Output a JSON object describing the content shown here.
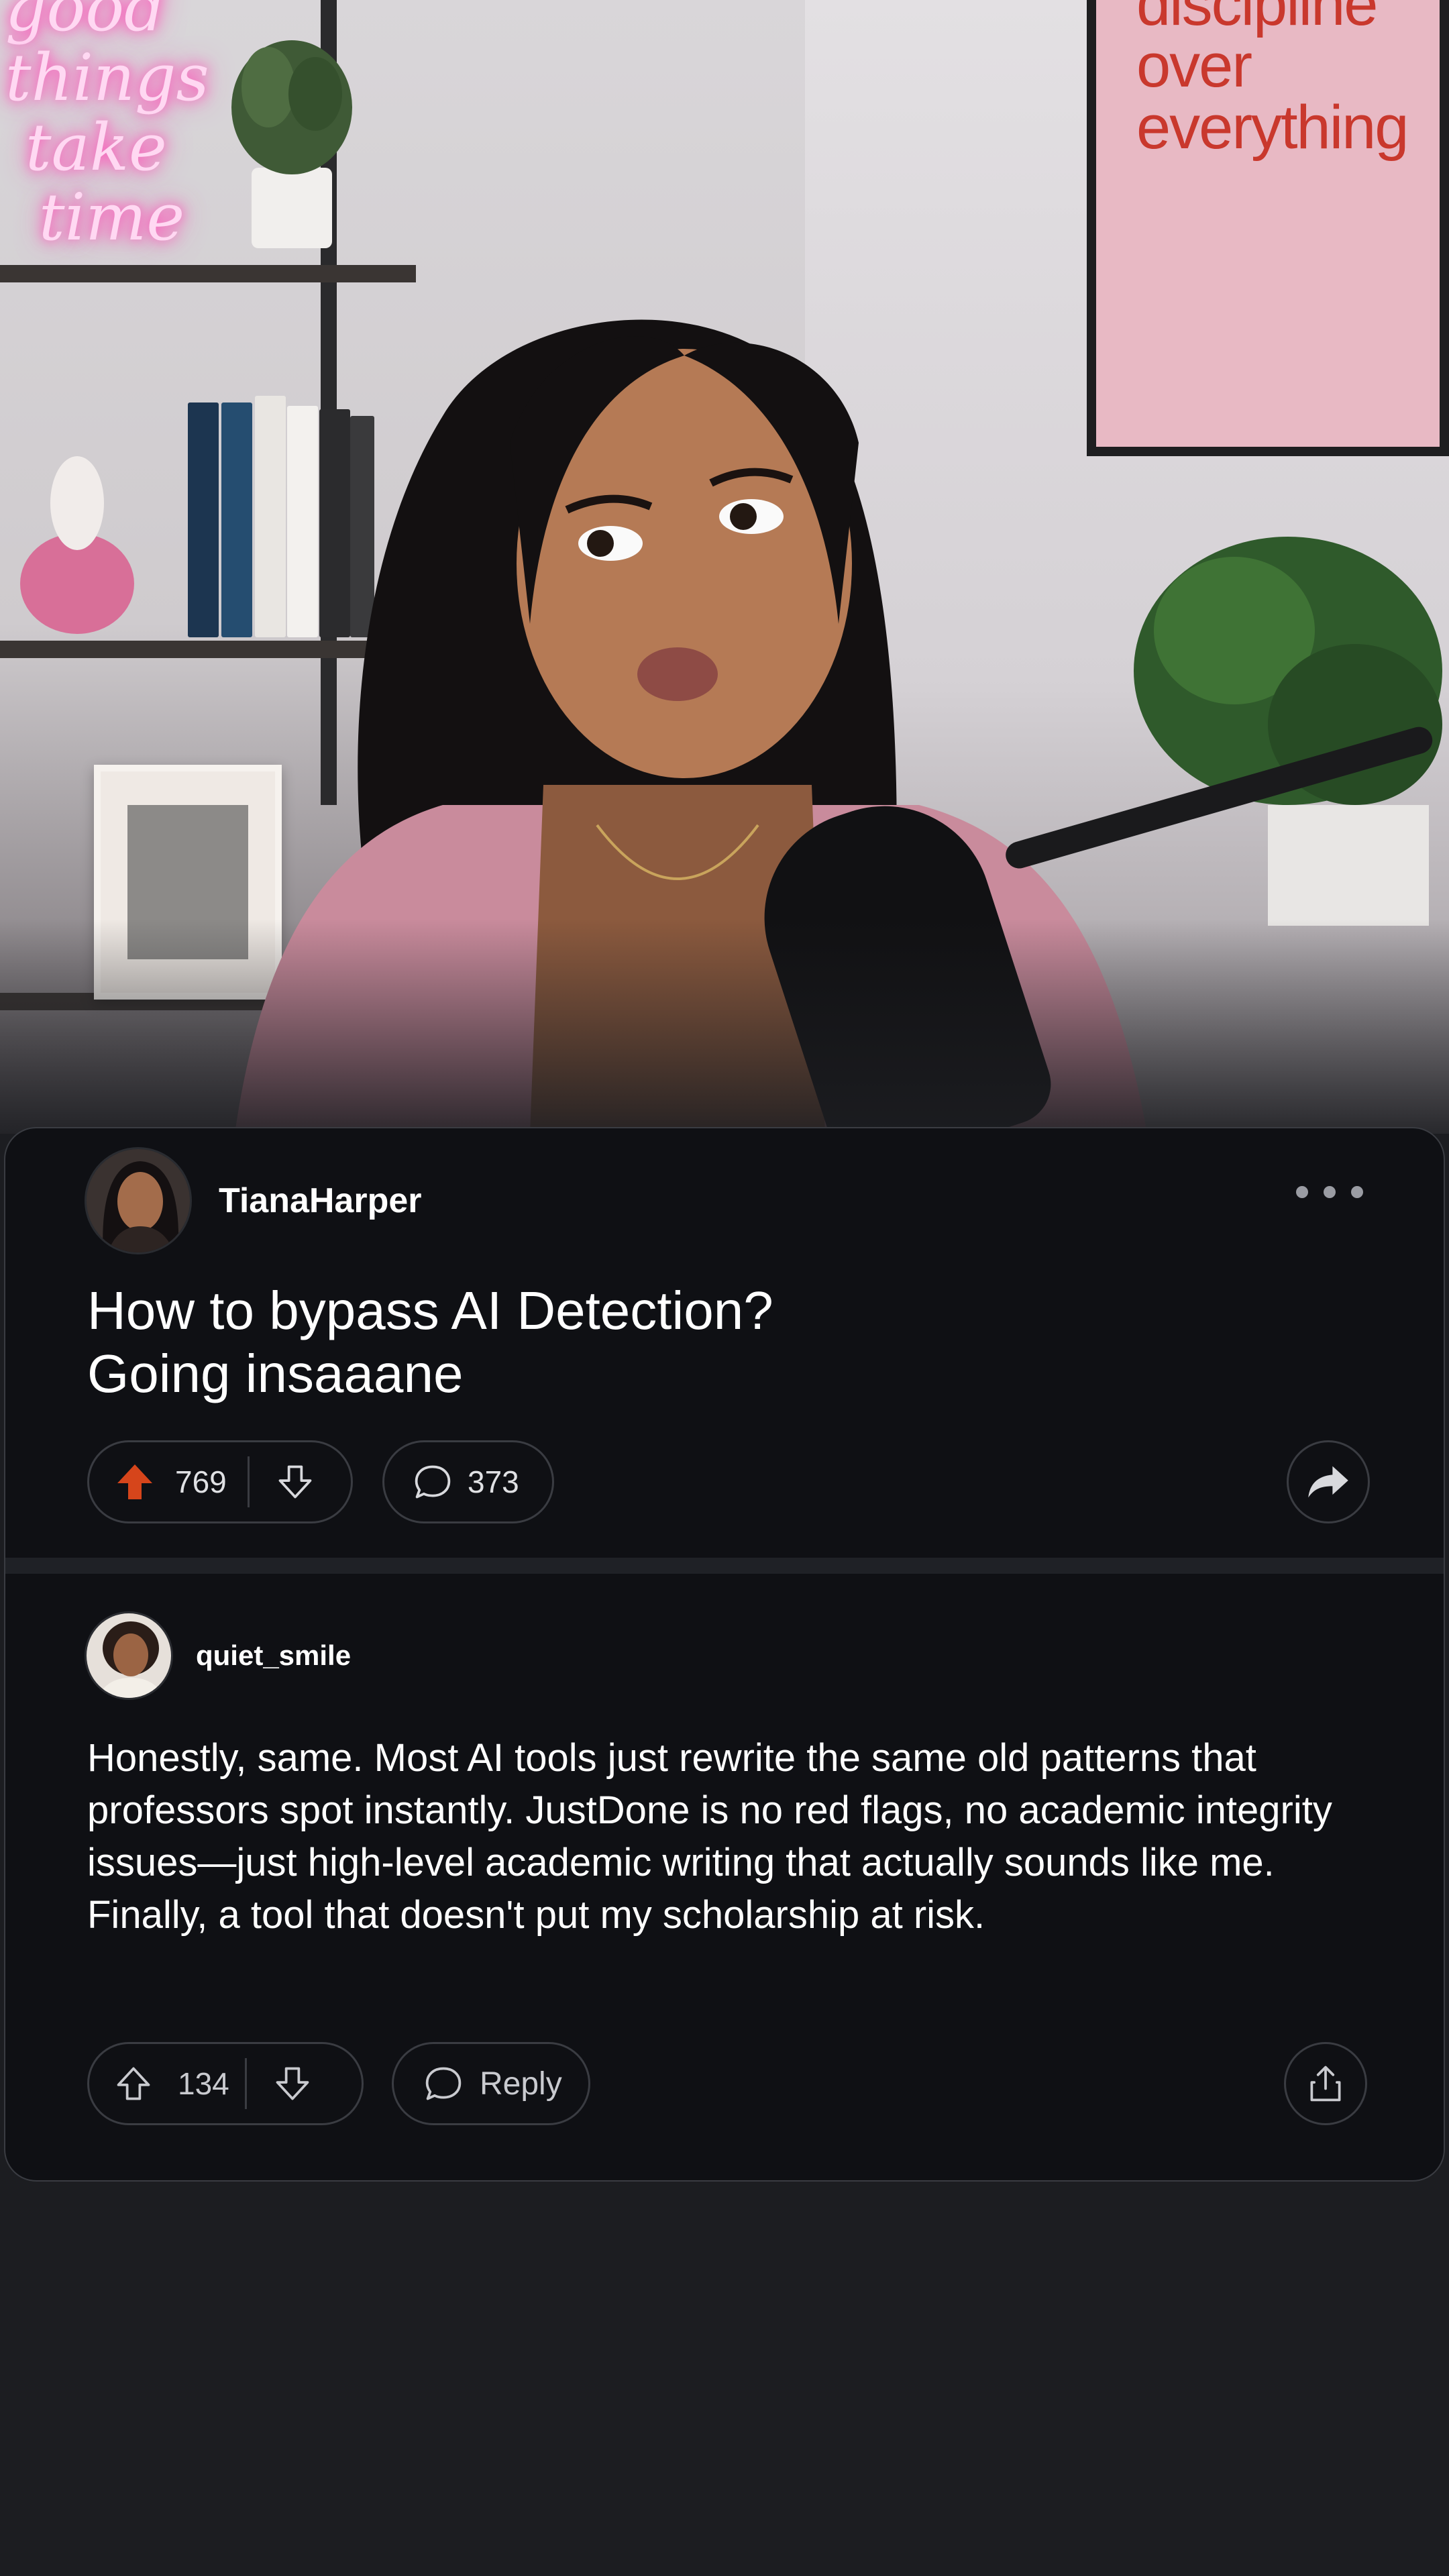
{
  "background": {
    "neon_sign_text": [
      "good",
      "things",
      "take",
      "time"
    ],
    "poster_text": [
      "discipline",
      "over",
      "everything"
    ]
  },
  "post": {
    "author": "TianaHarper",
    "title_lines": [
      "How to bypass AI Detection?",
      "Going insaaane"
    ],
    "upvotes": "769",
    "comments": "373",
    "upvote_color": "#d6451b"
  },
  "comment": {
    "author": "quiet_smile",
    "body": "Honestly, same. Most AI tools just rewrite the same old patterns that professors spot instantly. JustDone is no red flags, no academic integrity issues—just high-level academic writing that actually sounds like me. Finally, a tool that doesn't put my scholarship at risk.",
    "upvotes": "134",
    "reply_label": "Reply"
  },
  "icons": [
    "upvote-icon",
    "downvote-icon",
    "comment-icon",
    "share-arrow-icon",
    "share-box-icon",
    "more-icon"
  ]
}
